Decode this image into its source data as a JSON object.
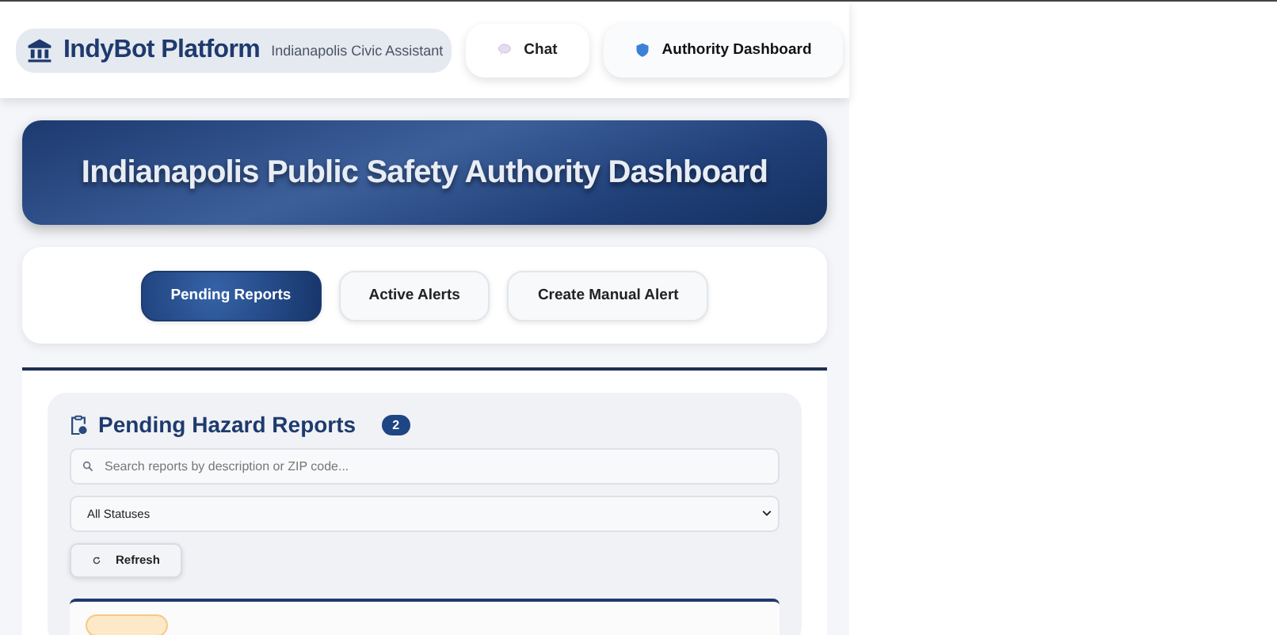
{
  "brand": {
    "name": "IndyBot Platform",
    "subtitle": "Indianapolis Civic Assistant"
  },
  "nav": [
    {
      "label": "Chat",
      "selected": false
    },
    {
      "label": "Authority Dashboard",
      "selected": true
    }
  ],
  "banner": {
    "title": "Indianapolis Public Safety Authority Dashboard"
  },
  "tabs": [
    {
      "label": "Pending Reports",
      "selected": true
    },
    {
      "label": "Active Alerts",
      "selected": false
    },
    {
      "label": "Create Manual Alert",
      "selected": false
    }
  ],
  "panel": {
    "title": "Pending Hazard Reports",
    "count": "2",
    "search": {
      "placeholder": "Search reports by description or ZIP code..."
    },
    "filter": {
      "value": "All Statuses"
    },
    "refresh": "Refresh"
  }
}
